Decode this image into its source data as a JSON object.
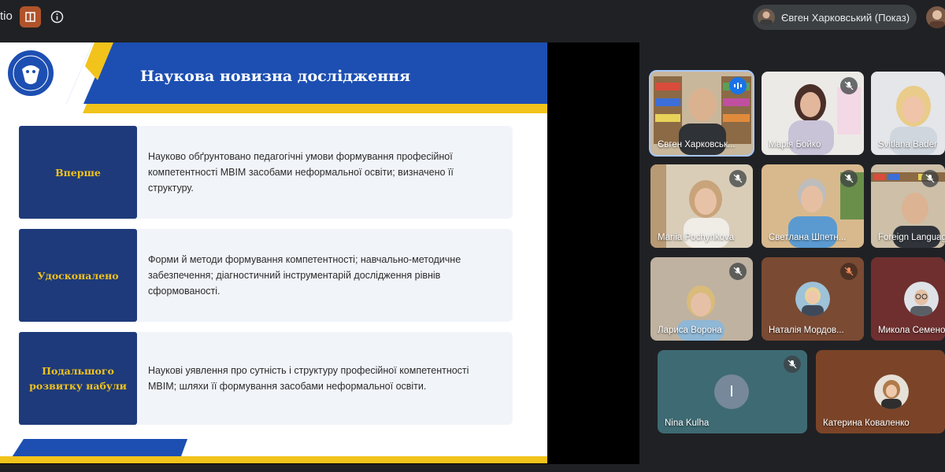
{
  "topbar": {
    "app_name_fragment": "tio",
    "presenter_label": "Євген Харковський (Показ)"
  },
  "slide": {
    "title": "Наукова новизна дослідження",
    "rows": [
      {
        "label": "Вперше",
        "text": "Науково обґрунтовано педагогічні умови формування професійної компетентності МВІМ засобами неформальної освіти; визначено її структуру."
      },
      {
        "label": "Удосконалено",
        "text": "Форми й методи формування компетентності; навчально-методичне забезпечення; діагностичний інструментарій дослідження рівнів сформованості."
      },
      {
        "label": "Подальшого розвитку набули",
        "text": "Наукові уявлення про сутність і структуру професійної компетентності МВІМ; шляхи її формування засобами неформальної освіти."
      }
    ]
  },
  "participants": [
    {
      "name": "Євген Харковськ...",
      "state": "speaking"
    },
    {
      "name": "Марія Бойко",
      "state": "muted"
    },
    {
      "name": "Svitlana Bader",
      "state": ""
    },
    {
      "name": "Mariia Pochynkova",
      "state": "muted"
    },
    {
      "name": "Светлана Шпетн...",
      "state": "muted"
    },
    {
      "name": "Foreign Language",
      "state": "muted"
    },
    {
      "name": "Лариса Ворона",
      "state": "muted"
    },
    {
      "name": "Наталія Мордов...",
      "state": "muted"
    },
    {
      "name": "Микола Семенов",
      "state": ""
    },
    {
      "name": "Nina Kulha",
      "state": "muted",
      "initial": "I"
    },
    {
      "name": "Катерина Коваленко",
      "state": ""
    }
  ],
  "colors": {
    "background": "#202124",
    "slide_blue": "#1d4fb2",
    "slide_navy": "#1e3a7a",
    "slide_yellow": "#f2c31b",
    "active_outline": "#a8c7fa"
  }
}
